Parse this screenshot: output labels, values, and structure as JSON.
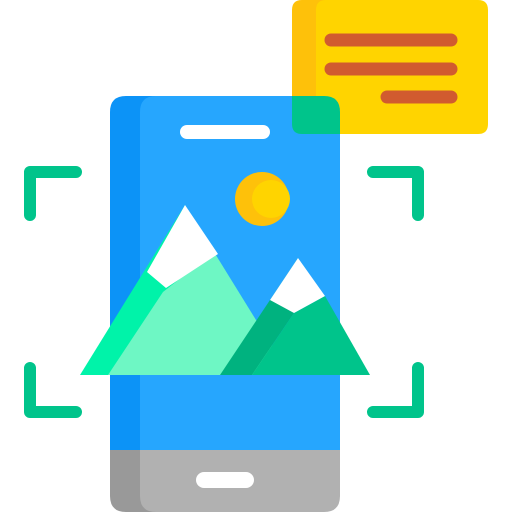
{
  "icon": {
    "name": "mobile-image-recognition-icon",
    "parts": [
      "phone-icon",
      "mountain-landscape-icon",
      "sun-icon",
      "scan-frame-icon",
      "text-note-icon"
    ]
  },
  "colors": {
    "phone_body_shade": "#0c93f7",
    "phone_body": "#26a6fe",
    "phone_base_shade": "#999999",
    "phone_base": "#b1b1b1",
    "speaker_and_button": "#ffffff",
    "sun_shade": "#fec10a",
    "sun": "#ffd400",
    "mountain_back_light": "#6ef7c4",
    "mountain_back_bright": "#00f3a9",
    "mountain_front": "#00c48b",
    "mountain_front_shade": "#00b27f",
    "snow": "#ffffff",
    "scan_corners": "#00c48b",
    "note_body": "#ffd400",
    "note_shade": "#fec10a",
    "note_overlap": "#00c48b",
    "note_lines": "#d15b2f"
  }
}
